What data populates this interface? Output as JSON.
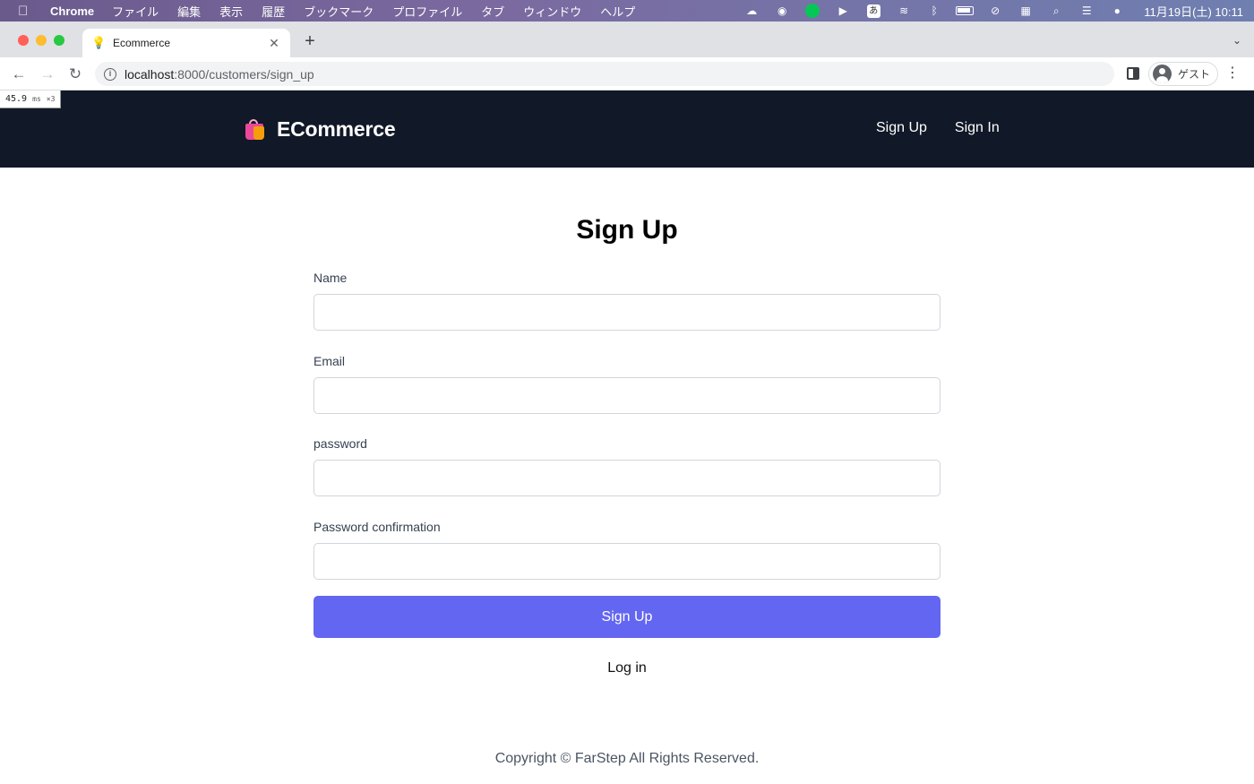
{
  "menubar": {
    "app": "Chrome",
    "items": [
      "ファイル",
      "編集",
      "表示",
      "履歴",
      "ブックマーク",
      "プロファイル",
      "タブ",
      "ウィンドウ",
      "ヘルプ"
    ],
    "clock": "11月19日(土) 10:11"
  },
  "browser": {
    "tab_title": "Ecommerce",
    "url_host": "localhost",
    "url_path": ":8000/customers/sign_up",
    "profile_label": "ゲスト"
  },
  "perf_overlay": {
    "value": "45.9",
    "unit": "ms",
    "multiplier": "×3"
  },
  "site": {
    "brand": "ECommerce",
    "nav": {
      "sign_up": "Sign Up",
      "sign_in": "Sign In"
    }
  },
  "form": {
    "title": "Sign Up",
    "fields": [
      {
        "label": "Name",
        "value": ""
      },
      {
        "label": "Email",
        "value": ""
      },
      {
        "label": "password",
        "value": ""
      },
      {
        "label": "Password confirmation",
        "value": ""
      }
    ],
    "submit_label": "Sign Up",
    "login_link": "Log in"
  },
  "footer": {
    "text": "Copyright © FarStep All Rights Reserved."
  },
  "colors": {
    "header_bg": "#111827",
    "primary": "#6366f1"
  }
}
